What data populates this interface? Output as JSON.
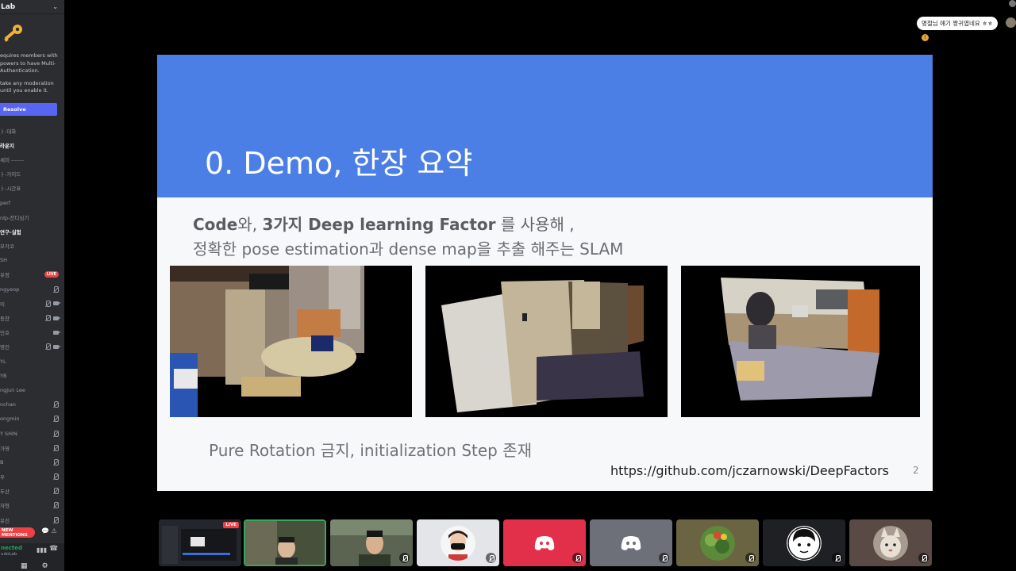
{
  "sidebar": {
    "server_name": "Lab",
    "mfa_text_1": "equires members with powers to have Multi- Authentication.",
    "mfa_text_2": "take any moderation until you enable it.",
    "resolve_label": "Resolve",
    "channels": [
      {
        "label": "ㅏ-대화",
        "bold": false
      },
      {
        "label": "라운지",
        "bold": true
      },
      {
        "label": "세미 -------",
        "bold": false
      },
      {
        "label": "ㅏ-가이드",
        "bold": false
      },
      {
        "label": "ㅏ-시간표",
        "bold": false
      },
      {
        "label": "perf",
        "bold": false
      },
      {
        "label": "nlp-잔디심기",
        "bold": false
      },
      {
        "label": "연구-실험",
        "bold": true
      },
      {
        "label": "모각코",
        "bold": false
      },
      {
        "label": "SH",
        "bold": false
      },
      {
        "label": "유정",
        "bold": false,
        "live": "LIVE"
      },
      {
        "label": "ngyeop",
        "bold": false,
        "mic_off": true
      },
      {
        "label": "이",
        "bold": false,
        "mic_off": true,
        "cam": true
      },
      {
        "label": "동찬",
        "bold": false,
        "mic_off": true,
        "cam": true
      },
      {
        "label": "민호",
        "bold": false,
        "cam": true
      },
      {
        "label": "영진",
        "bold": false,
        "mic_off": true,
        "cam": true
      },
      {
        "label": "YL",
        "bold": false
      },
      {
        "label": "YB",
        "bold": false
      },
      {
        "label": "ngjun Lee",
        "bold": false
      },
      {
        "label": "nchan",
        "bold": false,
        "mic_off": true
      },
      {
        "label": "ongmin",
        "bold": false,
        "mic_off": true
      },
      {
        "label": "Y SHIN",
        "bold": false,
        "mic_off": true
      },
      {
        "label": "가영",
        "bold": false,
        "mic_off": true
      },
      {
        "label": "B",
        "bold": false,
        "mic_off": true
      },
      {
        "label": "우",
        "bold": false,
        "mic_off": true
      },
      {
        "label": "두산",
        "bold": false,
        "mic_off": true
      },
      {
        "label": "자형",
        "bold": false,
        "mic_off": true
      },
      {
        "label": "유진",
        "bold": false,
        "mic_off": true
      }
    ],
    "new_mentions": "NEW MENTIONS",
    "voice_status": "nected",
    "voice_server": "udoLab"
  },
  "slide": {
    "title": "0. Demo, 한장 요약",
    "line1_a": "Code",
    "line1_b": "와, ",
    "line1_c": "3가지 Deep learning Factor",
    "line1_d": " 를 사용해 ,",
    "line2": "정확한 pose estimation과 dense map을 추출 해주는 SLAM",
    "note": "Pure Rotation 금지, initialization Step 존재",
    "url": "https://github.com/jczarnowski/DeepFactors",
    "page": "2"
  },
  "chat": {
    "message": "명철님 얘기 짱귀엽네요 ㅎㅎ"
  },
  "tiles": {
    "live_label": "LIVE"
  },
  "colors": {
    "slide_header": "#4b7fe5",
    "discord_red": "#ed4245",
    "discord_blurple": "#5865f2",
    "tile_red": "#e3304a",
    "tile_gray": "#6d7078"
  }
}
